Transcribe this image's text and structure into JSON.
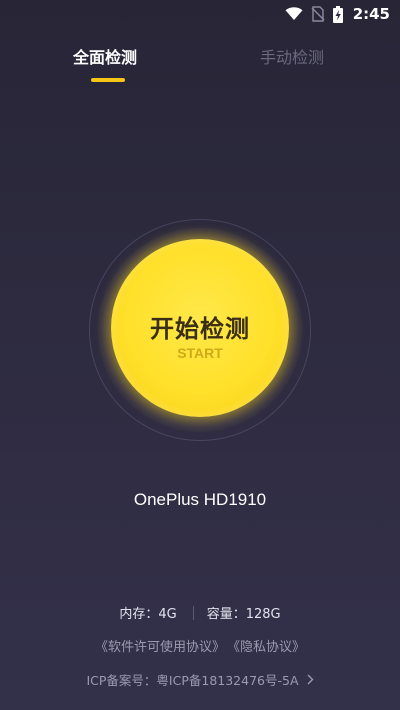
{
  "status_bar": {
    "time": "2:45",
    "icons": [
      "wifi-icon",
      "sim-no-signal-icon",
      "battery-charging-icon"
    ]
  },
  "tabs": [
    {
      "label": "全面检测",
      "active": true
    },
    {
      "label": "手动检测",
      "active": false
    }
  ],
  "start_button": {
    "title": "开始检测",
    "subtitle": "START"
  },
  "device": {
    "name": "OnePlus HD1910"
  },
  "specs": {
    "memory": "内存：4G",
    "storage": "容量：128G"
  },
  "agreements": {
    "software_license": "《软件许可使用协议》",
    "privacy": "《隐私协议》"
  },
  "icp": {
    "text": "ICP备案号：粤ICP备18132476号-5A"
  },
  "colors": {
    "accent": "#f5c518",
    "background": "#2e2b40",
    "button": "#ffe02a"
  }
}
